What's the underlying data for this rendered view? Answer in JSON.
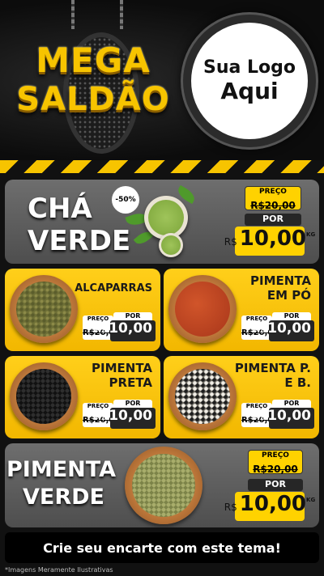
{
  "header": {
    "title_line1": "MEGA",
    "title_line2": "SALDÃO",
    "logo_line1": "Sua Logo",
    "logo_line2": "Aqui"
  },
  "featured_top": {
    "name_line1": "CHÁ",
    "name_line2": "VERDE",
    "discount": "-50%",
    "old_label": "PREÇO",
    "old_price": "R$20,00",
    "por_label": "POR",
    "currency": "R$",
    "price": "10,00",
    "unit": "KG"
  },
  "products": [
    {
      "name_line1": "ALCAPARRAS",
      "name_line2": "",
      "old_label": "PREÇO",
      "old_price": "R$20,00",
      "por_label": "POR",
      "currency": "R$",
      "price": "10,00"
    },
    {
      "name_line1": "PIMENTA",
      "name_line2": "EM PÓ",
      "old_label": "PREÇO",
      "old_price": "R$20,00",
      "por_label": "POR",
      "currency": "R$",
      "price": "10,00"
    },
    {
      "name_line1": "PIMENTA",
      "name_line2": "PRETA",
      "old_label": "PREÇO",
      "old_price": "R$20,00",
      "por_label": "POR",
      "currency": "R$",
      "price": "10,00"
    },
    {
      "name_line1": "PIMENTA P.",
      "name_line2": "E B.",
      "old_label": "PREÇO",
      "old_price": "R$20,00",
      "por_label": "POR",
      "currency": "R$",
      "price": "10,00"
    }
  ],
  "featured_bottom": {
    "name_line1": "PIMENTA",
    "name_line2": "VERDE",
    "old_label": "PREÇO",
    "old_price": "R$20,00",
    "por_label": "POR",
    "currency": "R$",
    "price": "10,00",
    "unit": "KG"
  },
  "cta": "Crie seu encarte com este tema!",
  "footnote": "*Imagens Meramente Ilustrativas",
  "colors": {
    "brand_yellow": "#f7c400",
    "panel_gray": "#5e5e5e",
    "dark": "#111111"
  }
}
